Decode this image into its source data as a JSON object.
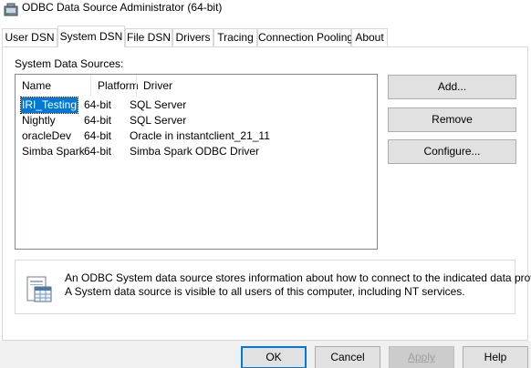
{
  "window": {
    "title": "ODBC Data Source Administrator (64-bit)",
    "icon": "odbc-app-icon"
  },
  "tabs": [
    {
      "label": "User DSN",
      "active": false
    },
    {
      "label": "System DSN",
      "active": true
    },
    {
      "label": "File DSN",
      "active": false
    },
    {
      "label": "Drivers",
      "active": false
    },
    {
      "label": "Tracing",
      "active": false
    },
    {
      "label": "Connection Pooling",
      "active": false
    },
    {
      "label": "About",
      "active": false
    }
  ],
  "system_dsn": {
    "section_label": "System Data Sources:",
    "columns": {
      "name": "Name",
      "platform": "Platform",
      "driver": "Driver"
    },
    "rows": [
      {
        "name": "IRI_Testing",
        "platform": "64-bit",
        "driver": "SQL Server",
        "selected": true
      },
      {
        "name": "Nightly",
        "platform": "64-bit",
        "driver": "SQL Server",
        "selected": false
      },
      {
        "name": "oracleDev",
        "platform": "64-bit",
        "driver": "Oracle in instantclient_21_11",
        "selected": false
      },
      {
        "name": "Simba Spark",
        "platform": "64-bit",
        "driver": "Simba Spark ODBC Driver",
        "selected": false
      }
    ],
    "buttons": {
      "add": "Add...",
      "remove": "Remove",
      "configure": "Configure..."
    },
    "info": {
      "icon": "data-source-info-icon",
      "line1": "An ODBC System data source stores information about how to connect to the indicated data provider.",
      "line2": "A System data source is visible to all users of this computer, including NT services."
    }
  },
  "footer": {
    "ok": "OK",
    "cancel": "Cancel",
    "apply": "Apply",
    "help": "Help"
  },
  "colors": {
    "selection": "#0078d7",
    "button_face": "#e1e1e1",
    "default_border": "#0078d7"
  }
}
